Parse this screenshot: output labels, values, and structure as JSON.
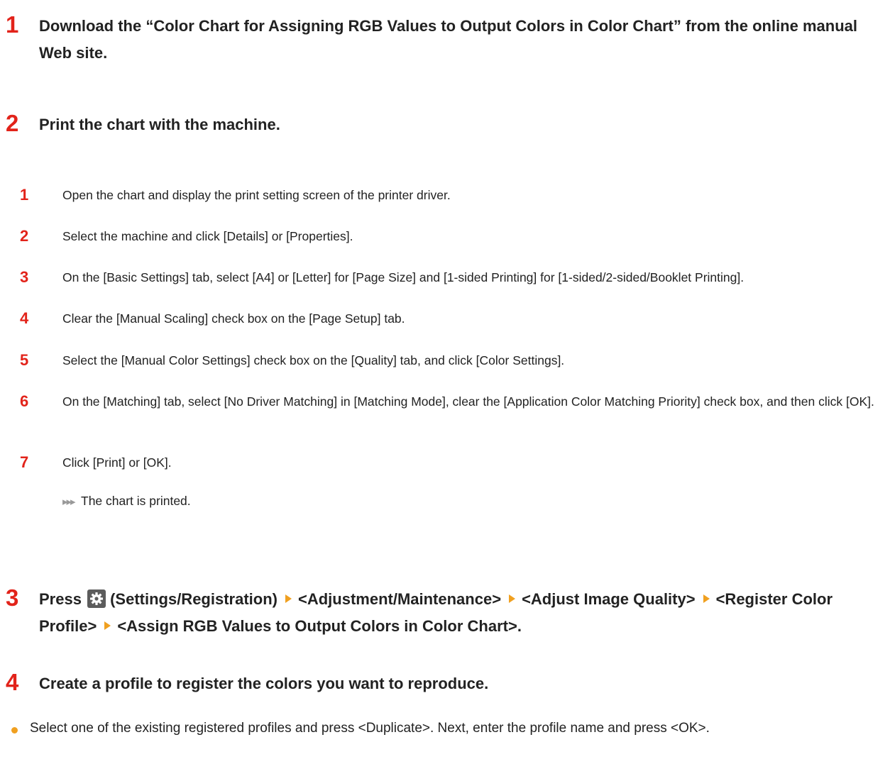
{
  "steps": [
    {
      "num": "1",
      "text": "Download the “Color Chart for Assigning RGB Values to Output Colors in Color Chart” from the online manual Web site."
    },
    {
      "num": "2",
      "text": "Print the chart with the machine."
    },
    {
      "num": "3",
      "press": "Press",
      "settings_label": "(Settings/Registration)",
      "crumbs": [
        "<Adjustment/Maintenance>",
        "<Adjust Image Quality>",
        "<Register Color Profile>",
        "<Assign RGB Values to Output Colors in Color Chart>."
      ]
    },
    {
      "num": "4",
      "text": "Create a profile to register the colors you want to reproduce."
    }
  ],
  "substeps": [
    {
      "num": "1",
      "text": "Open the chart and display the print setting screen of the printer driver."
    },
    {
      "num": "2",
      "text": "Select the machine and click [Details] or [Properties]."
    },
    {
      "num": "3",
      "text": "On the [Basic Settings] tab, select [A4] or [Letter] for [Page Size] and [1-sided Printing] for [1-sided/2-sided/Booklet Printing]."
    },
    {
      "num": "4",
      "text": "Clear the [Manual Scaling] check box on the [Page Setup] tab."
    },
    {
      "num": "5",
      "text": "Select the [Manual Color Settings] check box on the [Quality] tab, and click [Color Settings]."
    },
    {
      "num": "6",
      "text": "On the [Matching] tab, select [No Driver Matching] in [Matching Mode], clear the [Application Color Matching Priority] check box, and then click [OK]."
    },
    {
      "num": "7",
      "text": "Click [Print] or [OK]."
    }
  ],
  "result": {
    "arrow": "▸▸▸",
    "text": "The chart is printed."
  },
  "bullets": [
    {
      "text": "Select one of the existing registered profiles and press <Duplicate>. Next, enter the profile name and press <OK>."
    }
  ],
  "colors": {
    "step_number": "#e2231a",
    "breadcrumb_arrow": "#f0a020",
    "bullet": "#f0a020",
    "settings_icon_bg": "#5c5c5c"
  }
}
